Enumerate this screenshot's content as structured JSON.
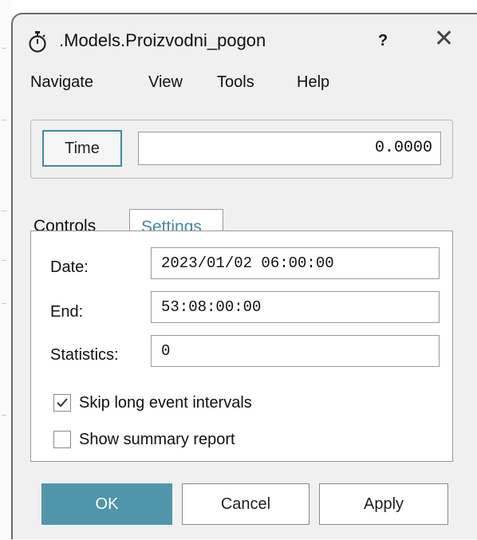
{
  "window": {
    "title": ".Models.Proizvodni_pogon",
    "help_label": "?",
    "close_label": "✕",
    "icon": "stopwatch-icon"
  },
  "menu": {
    "items": [
      "Navigate",
      "View",
      "Tools",
      "Help"
    ]
  },
  "time": {
    "button_label": "Time",
    "value": "0.0000"
  },
  "tabs": {
    "items": [
      "Controls",
      "Settings"
    ],
    "active": "Settings"
  },
  "settings": {
    "fields": [
      {
        "label": "Date:",
        "value": "2023/01/02 06:00:00"
      },
      {
        "label": "End:",
        "value": "53:08:00:00"
      },
      {
        "label": "Statistics:",
        "value": "0"
      }
    ],
    "checkboxes": [
      {
        "label": "Skip long event intervals",
        "checked": true
      },
      {
        "label": "Show summary report",
        "checked": false
      }
    ]
  },
  "buttons": {
    "ok": "OK",
    "cancel": "Cancel",
    "apply": "Apply"
  },
  "colors": {
    "accent": "#4f96ab",
    "tab_active_text": "#3f8aa0",
    "dialog_bg": "#f0f0f0"
  }
}
